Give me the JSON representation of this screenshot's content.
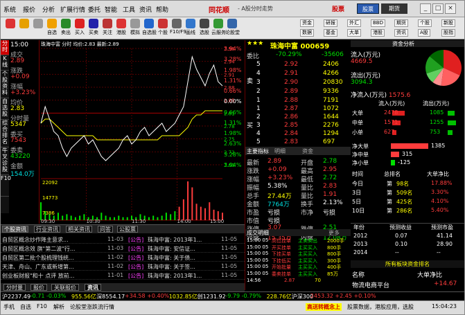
{
  "app": {
    "title": "同花顺",
    "subtitle": "- A股分时走势",
    "logo": "股票",
    "stock_btn": "股票",
    "futures_btn": "期货"
  },
  "colors": {
    "up": "#ff3c3c",
    "down": "#00e000",
    "price": "#ffff00",
    "bg": "#000000",
    "accent": "#2a5bb0"
  },
  "menu": [
    "系统",
    "报价",
    "分析",
    "扩展行情",
    "委托",
    "智能",
    "工具",
    "资讯",
    "帮助"
  ],
  "window": {
    "min": "_",
    "max": "□",
    "close": "×"
  },
  "toolbar": [
    {
      "label": "",
      "icon": "color-block-icon",
      "color": "#d33"
    },
    {
      "label": "",
      "icon": "back-arrow-icon",
      "color": "#e6a000"
    },
    {
      "label": "",
      "icon": "forward-arrow-icon",
      "color": "#999"
    },
    {
      "label": "自选",
      "icon": "star-icon",
      "color": "#f0a000"
    },
    {
      "label": "卖出",
      "icon": "sell-icon",
      "color": "#2a8a2a"
    },
    {
      "label": "买入",
      "icon": "buy-icon",
      "color": "#d22"
    },
    {
      "label": "买卖",
      "icon": "buysell-icon",
      "color": "#22a"
    },
    {
      "label": "关注",
      "icon": "focus-icon",
      "color": "#b33"
    },
    {
      "label": "港股",
      "icon": "hk-icon",
      "color": "#d33"
    },
    {
      "label": "模拟",
      "icon": "sim-icon",
      "color": "#999"
    },
    {
      "label": "自选股",
      "icon": "portfolio-icon",
      "color": "#2266cc"
    },
    {
      "label": "个股",
      "icon": "stock-icon",
      "color": "#cc3333"
    },
    {
      "label": "F10/F9",
      "icon": "f10-icon",
      "color": "#666"
    },
    {
      "label": "画线",
      "icon": "draw-icon",
      "color": "#3377cc"
    },
    {
      "label": "选股",
      "icon": "screener-icon",
      "color": "#444"
    },
    {
      "label": "云服务",
      "icon": "cloud-icon",
      "color": "#339933"
    },
    {
      "label": "论股堂",
      "icon": "forum-icon",
      "color": "#3366aa"
    }
  ],
  "rtb": [
    "资金",
    "研报",
    "外汇",
    "BBD",
    "期货",
    "个股",
    "新股",
    "数据",
    "基金",
    "大单",
    "港股",
    "资讯",
    "A股",
    "股指"
  ],
  "sidetabs": [
    "分时",
    "K线",
    "个股资料",
    "自选股",
    "综合排名",
    "牛叉诊股",
    "F10"
  ],
  "leftinfo": [
    {
      "t": "15:00",
      "c": "white"
    },
    {
      "t": "成交",
      "c": "gray"
    },
    {
      "t": "2.89",
      "c": "red"
    },
    {
      "t": "涨跌",
      "c": "gray"
    },
    {
      "t": "+0.09",
      "c": "red"
    },
    {
      "t": "涨幅",
      "c": "gray"
    },
    {
      "t": "+3.23%",
      "c": "red"
    },
    {
      "t": "均价",
      "c": "gray"
    },
    {
      "t": "2.83",
      "c": "yellow"
    },
    {
      "t": "分时量",
      "c": "gray"
    },
    {
      "t": "5347",
      "c": "yellow"
    },
    {
      "t": "委买",
      "c": "gray"
    },
    {
      "t": "7543",
      "c": "red"
    },
    {
      "t": "委卖",
      "c": "gray"
    },
    {
      "t": "43220",
      "c": "green"
    },
    {
      "t": "金额",
      "c": "gray"
    },
    {
      "t": "154.0万",
      "c": "cyan"
    }
  ],
  "chart": {
    "header": "珠海中富 分时 均价:2.83 最新:2.89",
    "prices": [
      2.8,
      2.84,
      2.81,
      2.78,
      2.77,
      2.74,
      2.72,
      2.74,
      2.75,
      2.76,
      2.77,
      2.75,
      2.76,
      2.74,
      2.72,
      2.71,
      2.72,
      2.73,
      2.74,
      2.76,
      2.77,
      2.75,
      2.76,
      2.78,
      2.79,
      2.77,
      2.78,
      2.79,
      2.8,
      2.78,
      2.79,
      2.8,
      2.82,
      2.84,
      2.9,
      2.96,
      2.93,
      2.91,
      2.89,
      2.92,
      2.94,
      2.9,
      2.89
    ],
    "avg": [
      2.8,
      2.81,
      2.81,
      2.8,
      2.79,
      2.78,
      2.77,
      2.77,
      2.77,
      2.77,
      2.77,
      2.77,
      2.77,
      2.76,
      2.76,
      2.76,
      2.76,
      2.76,
      2.76,
      2.76,
      2.76,
      2.76,
      2.76,
      2.76,
      2.76,
      2.76,
      2.76,
      2.76,
      2.77,
      2.77,
      2.77,
      2.77,
      2.77,
      2.78,
      2.79,
      2.81,
      2.82,
      2.82,
      2.83,
      2.83,
      2.83,
      2.83,
      2.83
    ],
    "ylim": [
      2.7,
      2.98
    ],
    "leftticks": [
      "2.98",
      "2.94",
      "2.91",
      "2.88",
      "2.85",
      "2.81",
      "2.78",
      "2.75",
      "2.72",
      "2.69"
    ],
    "rightticks": [
      {
        "t": "3.94%",
        "c": "red"
      },
      {
        "t": "3.28%",
        "c": "red"
      },
      {
        "t": "1.98%",
        "c": "red"
      },
      {
        "t": "1.31%",
        "c": "red"
      },
      {
        "t": "0.66%",
        "c": "red"
      },
      {
        "t": "0.00%",
        "c": "white"
      },
      {
        "t": "0.66%",
        "c": "green"
      },
      {
        "t": "1.31%",
        "c": "green"
      },
      {
        "t": "1.98%",
        "c": "green"
      },
      {
        "t": "2.63%",
        "c": "green"
      },
      {
        "t": "3.28%",
        "c": "green"
      },
      {
        "t": "3.94%",
        "c": "green"
      }
    ],
    "volticks": [
      "22092",
      "14773",
      "7386"
    ],
    "volumes": [
      12,
      6,
      4,
      3,
      5,
      3,
      4,
      3,
      2,
      3,
      4,
      2,
      3,
      2,
      5,
      3,
      2,
      2,
      3,
      2,
      2,
      3,
      2,
      4,
      3,
      2,
      3,
      2,
      3,
      5,
      4,
      6,
      9,
      14,
      26,
      22,
      11,
      9,
      8,
      12,
      7,
      6,
      5
    ],
    "times": [
      "09:30",
      "10:30",
      "11:30",
      "14:00",
      "15:00"
    ]
  },
  "panel": {
    "title": "珠海中富 000659",
    "stars": "★★★",
    "weibi": {
      "label": "委比",
      "pct": "-70.29%",
      "val": "-35606"
    },
    "sells": [
      {
        "lv": "5",
        "p": "2.92",
        "v": "2406"
      },
      {
        "lv": "4",
        "p": "2.91",
        "v": "4266"
      },
      {
        "lv": "3",
        "p": "2.90",
        "v": "20830"
      },
      {
        "lv": "2",
        "p": "2.89",
        "v": "9336"
      },
      {
        "lv": "1",
        "p": "2.88",
        "v": "7191"
      }
    ],
    "buys": [
      {
        "lv": "1",
        "p": "2.87",
        "v": "1072"
      },
      {
        "lv": "2",
        "p": "2.86",
        "v": "1644"
      },
      {
        "lv": "3",
        "p": "2.85",
        "v": "2276"
      },
      {
        "lv": "4",
        "p": "2.84",
        "v": "1294"
      },
      {
        "lv": "5",
        "p": "2.83",
        "v": "697"
      }
    ],
    "sell_side": "卖",
    "buy_side": "买",
    "tabs": [
      "主要指标",
      "明细",
      "资金"
    ],
    "quote": [
      {
        "l1": "最新",
        "v1": "2.89",
        "c1": "red",
        "l2": "开盘",
        "v2": "2.78",
        "c2": "green"
      },
      {
        "l1": "涨跌",
        "v1": "+0.09",
        "c1": "red",
        "l2": "最高",
        "v2": "2.95",
        "c2": "red"
      },
      {
        "l1": "涨幅",
        "v1": "+3.23%",
        "c1": "red",
        "l2": "最低",
        "v2": "2.72",
        "c2": "green"
      },
      {
        "l1": "振幅",
        "v1": "5.38%",
        "c1": "white",
        "l2": "量比",
        "v2": "2.83",
        "c2": "red"
      },
      {
        "l1": "总手",
        "v1": "27.44万",
        "c1": "yellow",
        "l2": "量比",
        "v2": "1.91",
        "c2": "red"
      },
      {
        "l1": "金额",
        "v1": "7764万",
        "c1": "cyan",
        "l2": "换手",
        "v2": "2.13%",
        "c2": "white"
      },
      {
        "l1": "市盈",
        "v1": "亏损",
        "c1": "white",
        "l2": "市净",
        "v2": "亏损",
        "c2": "white"
      },
      {
        "l1": "市值",
        "v1": "亏损",
        "c1": "white",
        "l2": "",
        "v2": "",
        "c2": "white"
      },
      {
        "l1": "涨停",
        "v1": "3.07",
        "c1": "red",
        "l2": "跌停",
        "v2": "2.51",
        "c2": "green"
      },
      {
        "l1": "外盘",
        "v1": "15.35万",
        "c1": "red",
        "l2": "内盘",
        "v2": "12.08万",
        "c2": "green"
      }
    ]
  },
  "rpanel": {
    "header": "资金分析",
    "inflow": {
      "label": "流入(万元)",
      "value": "4669.5"
    },
    "outflow": {
      "label": "流出(万元)",
      "value": "3094.3"
    },
    "net": {
      "label": "净流入(万元)",
      "value": "1575.6"
    },
    "cols": [
      "流入(万元)",
      "流出(万元)"
    ],
    "rows": [
      {
        "name": "大单",
        "inv": "2478",
        "outv": "1085",
        "ib": 0.9,
        "ob": 0.5
      },
      {
        "name": "中单",
        "inv": "1571",
        "outv": "1255",
        "ib": 0.6,
        "ob": 0.6
      },
      {
        "name": "小单",
        "inv": "627",
        "outv": "753",
        "ib": 0.3,
        "ob": 0.35
      }
    ],
    "nets": [
      {
        "name": "净大单",
        "v": "1385",
        "frac": 0.9,
        "color": "#ff3c3c"
      },
      {
        "name": "净中单",
        "v": "315",
        "frac": 0.2,
        "color": "#ff3c3c"
      },
      {
        "name": "净小单",
        "v": "-125",
        "frac": 0.1,
        "color": "#00e000"
      }
    ],
    "pie": [
      {
        "name": "大单流入",
        "v": 2478,
        "color": "#e02020"
      },
      {
        "name": "中单流入",
        "v": 1571,
        "color": "#ff6060"
      },
      {
        "name": "小单流入",
        "v": 627,
        "color": "#ff9090"
      },
      {
        "name": "小单流出",
        "v": 753,
        "color": "#60d060"
      },
      {
        "name": "中单流出",
        "v": 1255,
        "color": "#20a020"
      },
      {
        "name": "大单流出",
        "v": 1085,
        "color": "#006600"
      }
    ],
    "pie_label": "",
    "rank_header": {
      "time": "时间",
      "total": "总排名",
      "net": "大单净比"
    },
    "rank": [
      {
        "t": "今日",
        "r1": "第",
        "r2": "98名",
        "p": "17.88%",
        "c": "red"
      },
      {
        "t": "3日",
        "r1": "第",
        "r2": "509名",
        "p": "3.30%",
        "c": "red"
      },
      {
        "t": "5日",
        "r1": "第",
        "r2": "425名",
        "p": "4.10%",
        "c": "red"
      },
      {
        "t": "10日",
        "r1": "第",
        "r2": "286名",
        "p": "5.40%",
        "c": "red"
      }
    ],
    "fore_header": {
      "year": "年份",
      "eps": "预测收益",
      "pe": "预测市盈"
    },
    "fore": [
      {
        "y": "2012",
        "e": "0.07",
        "pe": "41.14"
      },
      {
        "y": "2013",
        "e": "0.10",
        "pe": "28.90"
      },
      {
        "y": "2014",
        "e": "--",
        "pe": "--"
      }
    ],
    "sector_header": "所有板块资金排名",
    "sector_cols": {
      "name": "名称",
      "net": "大单净比"
    },
    "sector": {
      "name": "物流电商平台",
      "v": "+14.67"
    }
  },
  "news": {
    "tabs": [
      "个股资讯",
      "行业资讯",
      "相关资讯",
      "问答",
      "公股票"
    ],
    "items": [
      {
        "t": "自贸区概念炒作降主意求...",
        "d": "11-03",
        "src": "[公告]",
        "title": "珠海中富: 2013年1...",
        "d2": "11-05"
      },
      {
        "t": "自贸区概念效 旗\"第二波\"行...",
        "d": "11-03",
        "src": "[公告]",
        "title": "珠海中富: 安信证...",
        "d2": "11-05"
      },
      {
        "t": "自贸区第二批个股梳理钱统...",
        "d": "11-02",
        "src": "[公告]",
        "title": "珠海中富: 关于债...",
        "d2": "11-05"
      },
      {
        "t": "天津、舟山、广东或新增第...",
        "d": "11-02",
        "src": "[公告]",
        "title": "珠海中富: 关于签...",
        "d2": "11-05"
      },
      {
        "t": "创业板财报\"和十 点评 放前...",
        "d": "11-01",
        "src": "[公告]",
        "title": "珠海中富: 2013年1...",
        "d2": "11-05"
      }
    ]
  },
  "btabs": [
    "分时量",
    "报价",
    "关联报价",
    "资讯"
  ],
  "trades": {
    "title": "成交明细",
    "tail": "更多",
    "items": [
      {
        "t": "15:00 05",
        "a": "高位挂单",
        "b": "主卖卖出",
        "n": "2000手"
      },
      {
        "t": "15:00 05",
        "a": "开买挂单",
        "b": "主买买入",
        "n": "800手"
      },
      {
        "t": "15:00 05",
        "a": "下挂买单",
        "b": "主买买入",
        "n": "800手"
      },
      {
        "t": "15:00 05",
        "a": "下挂低买",
        "b": "主买买入",
        "n": "300手"
      },
      {
        "t": "15:00 05",
        "a": "开始批量",
        "b": "主买买入",
        "n": "400手"
      },
      {
        "t": "15:00 05",
        "a": "委卖挂单",
        "b": "主买买入",
        "n": "85万"
      }
    ],
    "sum": {
      "t": "14:56",
      "p": "2.87",
      "v": "70"
    }
  },
  "status": [
    {
      "t": "沪2237.49",
      "c": "white"
    },
    {
      "t": "-0.71 -0.03%",
      "c": "green"
    },
    {
      "t": "955.56亿",
      "c": "yellow"
    },
    {
      "t": "深8554.17",
      "c": "white"
    },
    {
      "t": "+34.58 +0.40%",
      "c": "red"
    },
    {
      "t": "1032.85亿",
      "c": "yellow"
    },
    {
      "t": "创1231.92",
      "c": "white"
    },
    {
      "t": "-9.79 -0.79%",
      "c": "green"
    },
    {
      "t": "228.76亿",
      "c": "yellow"
    },
    {
      "t": "沪深300",
      "c": "white"
    },
    {
      "t": "2453.32 +2.45 +0.10%",
      "c": "red"
    }
  ],
  "bottom": {
    "items": [
      "手机",
      "自选",
      "F10",
      "解析",
      "论股堂",
      "涨跌流",
      "行情"
    ],
    "promo": "高送转概念上",
    "promo2": "股票数据，港股应用，选股",
    "time": "15:04:23"
  }
}
